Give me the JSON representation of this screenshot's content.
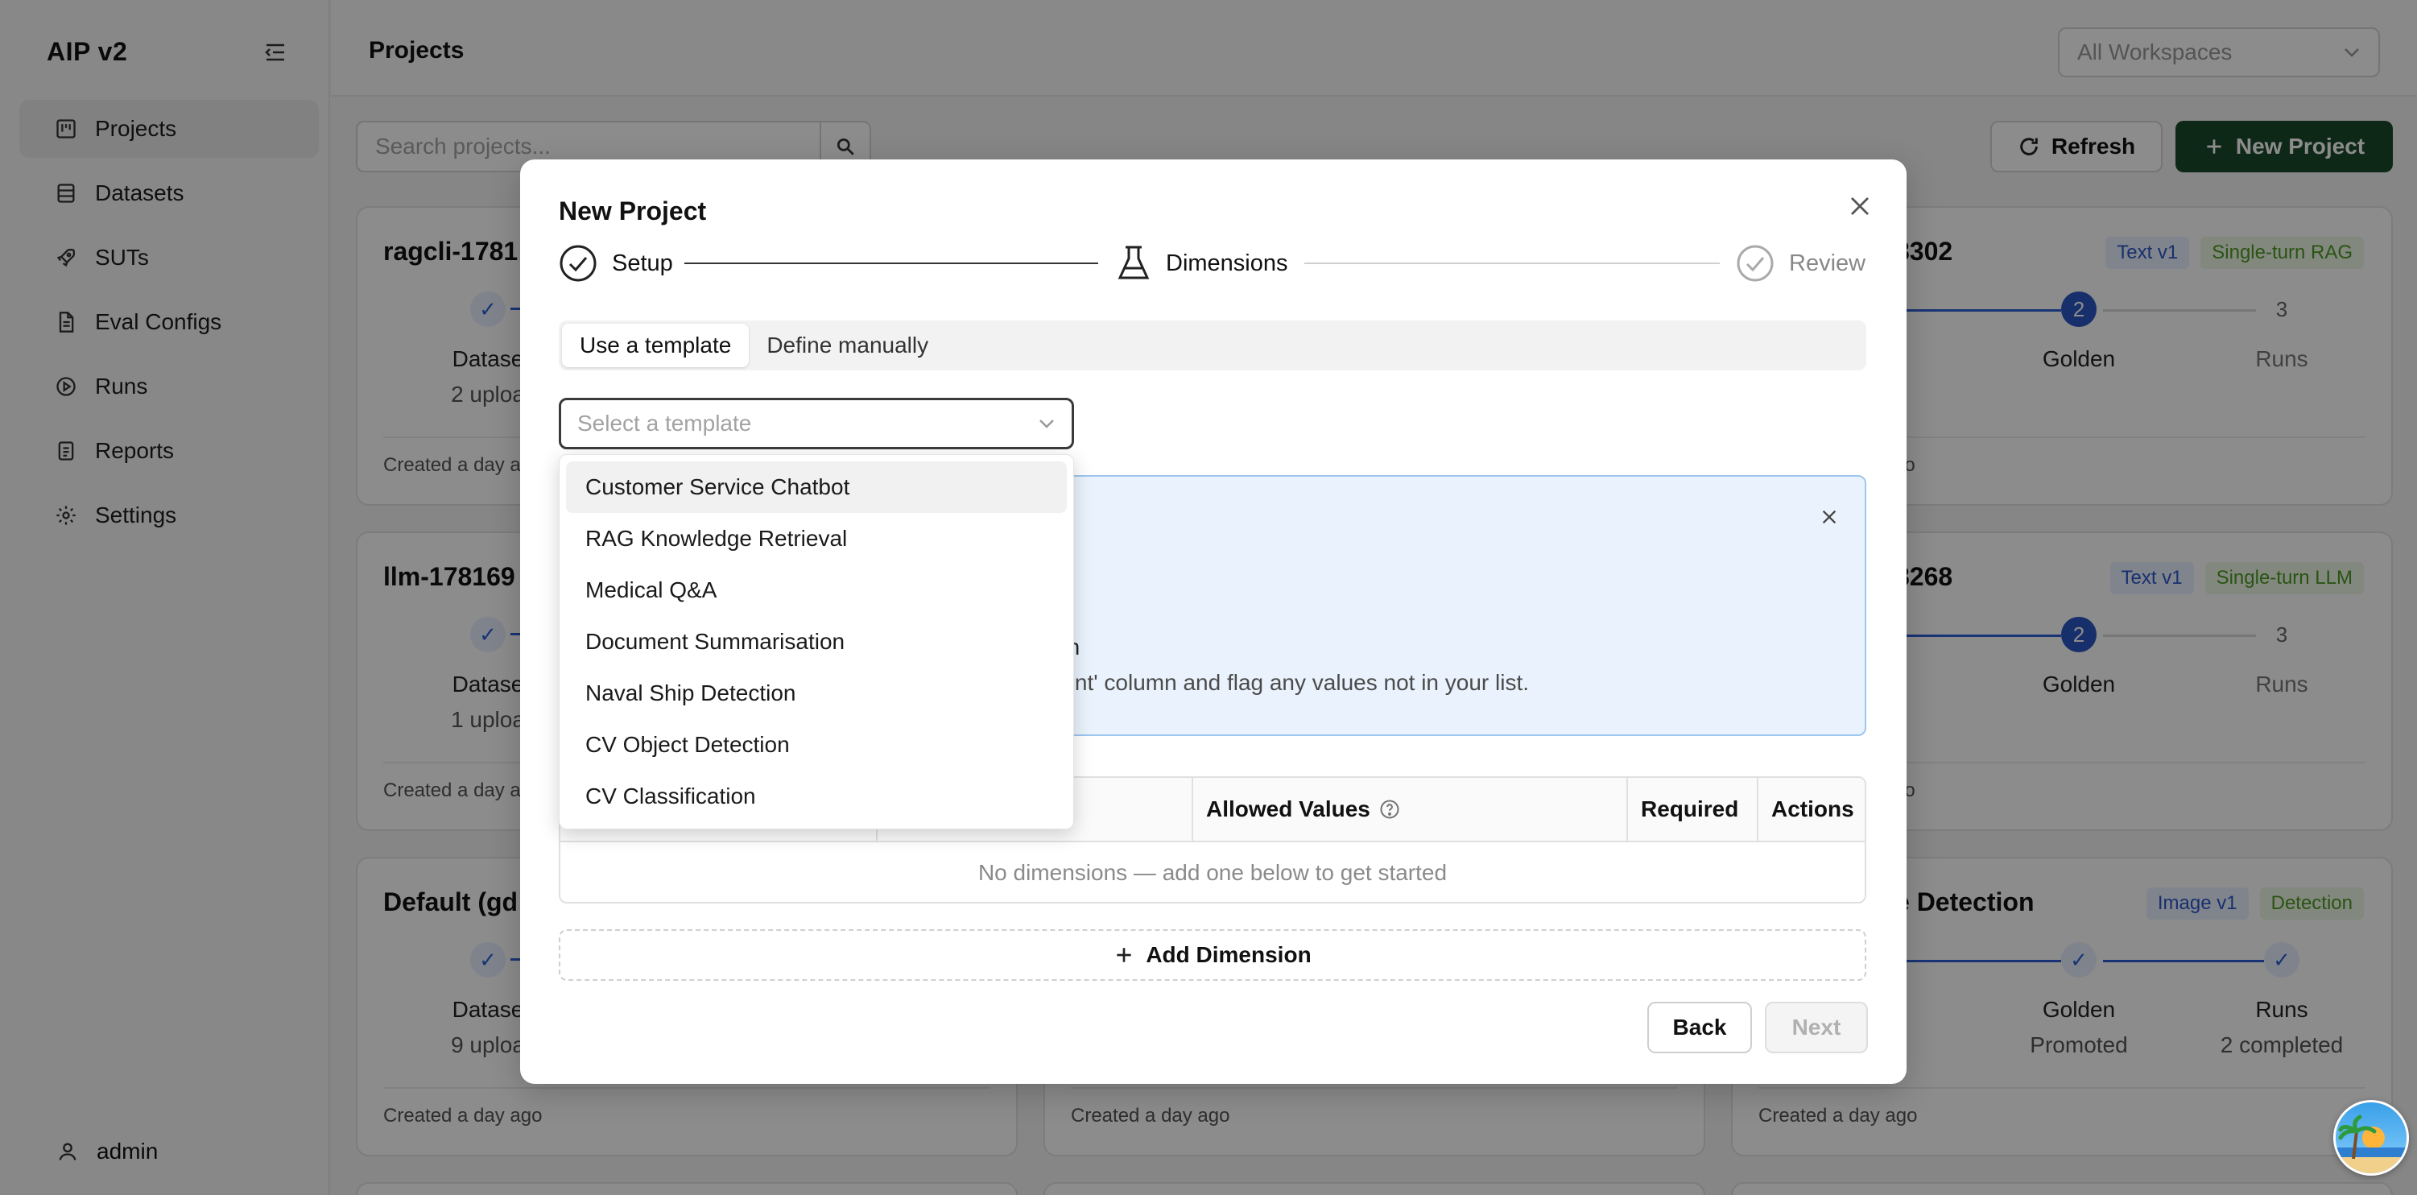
{
  "sidebar": {
    "brand": "AIP v2",
    "items": [
      {
        "label": "Projects",
        "icon": "board-icon"
      },
      {
        "label": "Datasets",
        "icon": "database-icon"
      },
      {
        "label": "SUTs",
        "icon": "rocket-icon"
      },
      {
        "label": "Eval Configs",
        "icon": "file-icon"
      },
      {
        "label": "Runs",
        "icon": "play-circle-icon"
      },
      {
        "label": "Reports",
        "icon": "report-icon"
      },
      {
        "label": "Settings",
        "icon": "gear-icon"
      }
    ],
    "user": "admin"
  },
  "header": {
    "title": "Projects",
    "workspace_select": "All Workspaces"
  },
  "toolbar": {
    "search_placeholder": "Search projects...",
    "refresh_label": "Refresh",
    "new_project_label": "New Project"
  },
  "cards": [
    {
      "title": "ragcli-1781",
      "step1_label": "Datase",
      "step1_sub": "2 uploa",
      "footer": "Created a day a"
    },
    {
      "title": "llm-178169",
      "step1_label": "Datase",
      "step1_sub": "1 uploa",
      "footer": "Created a day a"
    },
    {
      "title": "Default (gd",
      "step1_label": "Datase",
      "step1_sub": "9 uploa",
      "footer": "Created a day ago"
    },
    {
      "title": "",
      "footer": "Created a day ago"
    },
    {
      "title": "8302",
      "tags": [
        "Text v1",
        "Single-turn RAG"
      ],
      "step1_sub": "d",
      "step2_label": "Golden",
      "step3_label": "Runs",
      "step2_num": "2",
      "step3_num": "3",
      "footer": "go"
    },
    {
      "title": "8268",
      "tags": [
        "Text v1",
        "Single-turn LLM"
      ],
      "step1_sub": "d",
      "step2_label": "Golden",
      "step3_label": "Runs",
      "step2_num": "2",
      "step3_num": "3",
      "footer": "go"
    },
    {
      "title": "e Detection",
      "tags": [
        "Image v1",
        "Detection"
      ],
      "step1_sub": "d",
      "step2_label": "Golden",
      "step2_sub": "Promoted",
      "step3_label": "Runs",
      "step3_sub": "2 completed",
      "footer": "Created a day ago"
    }
  ],
  "modal": {
    "title": "New Project",
    "steps": [
      {
        "label": "Setup",
        "state": "done"
      },
      {
        "label": "Dimensions",
        "state": "active"
      },
      {
        "label": "Review",
        "state": "pending"
      }
    ],
    "tabs": [
      {
        "label": "Use a template",
        "active": true
      },
      {
        "label": "Define manually",
        "active": false
      }
    ],
    "template_placeholder": "Select a template",
    "info_line1": "tion",
    "info_line2": "ntent' column and flag any values not in your list.",
    "table_headers": [
      "Allowed Values",
      "Required",
      "Actions"
    ],
    "empty_message": "No dimensions — add one below to get started",
    "add_dimension": "Add Dimension",
    "back": "Back",
    "next": "Next"
  },
  "dropdown": {
    "options": [
      "Customer Service Chatbot",
      "RAG Knowledge Retrieval",
      "Medical Q&A",
      "Document Summarisation",
      "Naval Ship Detection",
      "CV Object Detection",
      "CV Classification"
    ]
  },
  "colors": {
    "primary_green": "#1a4a2c",
    "accent_blue": "#2a56c4",
    "info_bg": "#eaf3fd"
  }
}
